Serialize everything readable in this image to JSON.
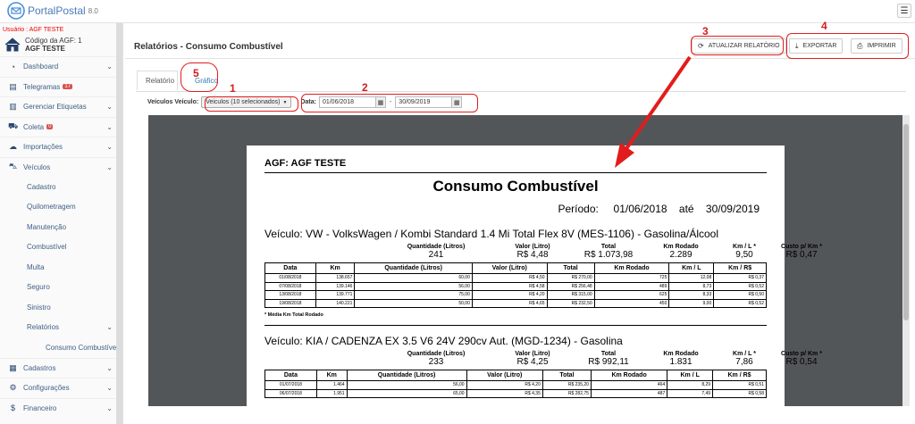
{
  "app": {
    "name": "PortalPostal",
    "version": "8.0"
  },
  "user_label": "Usuário : AGF TESTE",
  "agf": {
    "code_label": "Código da AGF: 1",
    "name": "AGF TESTE"
  },
  "sidebar": {
    "items": [
      {
        "icon": "dashboard-icon",
        "label": "Dashboard",
        "chev": true
      },
      {
        "icon": "newspaper-icon",
        "label": "Telegramas",
        "badge": "17"
      },
      {
        "icon": "barcode-icon",
        "label": "Gerenciar Etiquetas",
        "chev": true
      },
      {
        "icon": "truck-icon",
        "label": "Coleta",
        "badge": "0",
        "chev": true
      },
      {
        "icon": "cloud-icon",
        "label": "Importações",
        "chev": true
      },
      {
        "icon": "car-icon",
        "label": "Veículos",
        "chev": true
      }
    ],
    "sub": [
      "Cadastro",
      "Quilometragem",
      "Manutenção",
      "Combustível",
      "Multa",
      "Seguro",
      "Sinistro",
      "Relatórios"
    ],
    "subsub": "Consumo Combustível",
    "bottom": [
      {
        "icon": "table-icon",
        "label": "Cadastros"
      },
      {
        "icon": "cogs-icon",
        "label": "Configurações"
      },
      {
        "icon": "money-icon",
        "label": "Financeiro"
      }
    ]
  },
  "header": {
    "title": "Relatórios - Consumo Combustível",
    "refresh_label": "ATUALIZAR RELATÓRIO",
    "export_label": "EXPORTAR",
    "print_label": "IMPRIMIR"
  },
  "tabs": {
    "report": "Relatório",
    "chart": "Gráfico"
  },
  "filters": {
    "vehicle_label": "Veículos Veículo:",
    "vehicle_value": "Veiculos (10 selecionados)",
    "date_label": "Data:",
    "date_from": "01/06/2018",
    "date_sep": "-",
    "date_to": "30/09/2019"
  },
  "annotations": {
    "n1": "1",
    "n2": "2",
    "n3": "3",
    "n4": "4",
    "n5": "5"
  },
  "report": {
    "agf": "AGF: AGF TESTE",
    "title": "Consumo Combustível",
    "period": "Período:     01/06/2018    até    30/09/2019",
    "summary_headers": [
      "Quantidade (Litros)",
      "Valor (Litro)",
      "Total",
      "Km Rodado",
      "Km / L *",
      "Custo p/ Km *"
    ],
    "table_headers": [
      "Data",
      "Km",
      "Quantidade (Litros)",
      "Valor (Litro)",
      "Total",
      "Km Rodado",
      "Km / L",
      "Km / R$"
    ],
    "note": "* Média Km Total Rodado",
    "vehicles": [
      {
        "title": "Veículo: VW - VolksWagen / Kombi Standard 1.4 Mi Total Flex 8V (MES-1106) - Gasolina/Álcool",
        "summary": [
          "241",
          "R$ 4,48",
          "R$ 1.073,98",
          "2.289",
          "9,50",
          "R$ 0,47"
        ],
        "rows": [
          [
            "01/08/2018",
            "138.657",
            "60,00",
            "R$ 4,50",
            "R$ 270,00",
            "725",
            "12,08",
            "R$ 0,37"
          ],
          [
            "07/08/2018",
            "139.146",
            "56,00",
            "R$ 4,58",
            "R$ 256,48",
            "489",
            "8,73",
            "R$ 0,52"
          ],
          [
            "13/08/2018",
            "139.771",
            "75,00",
            "R$ 4,20",
            "R$ 315,00",
            "625",
            "8,33",
            "R$ 0,50"
          ],
          [
            "19/08/2018",
            "140.221",
            "50,00",
            "R$ 4,65",
            "R$ 232,50",
            "450",
            "9,00",
            "R$ 0,52"
          ]
        ]
      },
      {
        "title": "Veículo: KIA / CADENZA EX 3.5 V6 24V 290cv Aut. (MGD-1234) - Gasolina",
        "summary": [
          "233",
          "R$ 4,25",
          "R$ 992,11",
          "1.831",
          "7,86",
          "R$ 0,54"
        ],
        "rows": [
          [
            "01/07/2018",
            "1.464",
            "56,00",
            "R$ 4,20",
            "R$ 235,20",
            "464",
            "8,29",
            "R$ 0,51"
          ],
          [
            "06/07/2018",
            "1.951",
            "65,00",
            "R$ 4,35",
            "R$ 282,75",
            "487",
            "7,49",
            "R$ 0,58"
          ]
        ]
      }
    ]
  },
  "colors": {
    "accent": "#e21c1c",
    "nav_text": "#3e5f85",
    "link": "#337ab7",
    "viewer_bg": "#535659"
  }
}
